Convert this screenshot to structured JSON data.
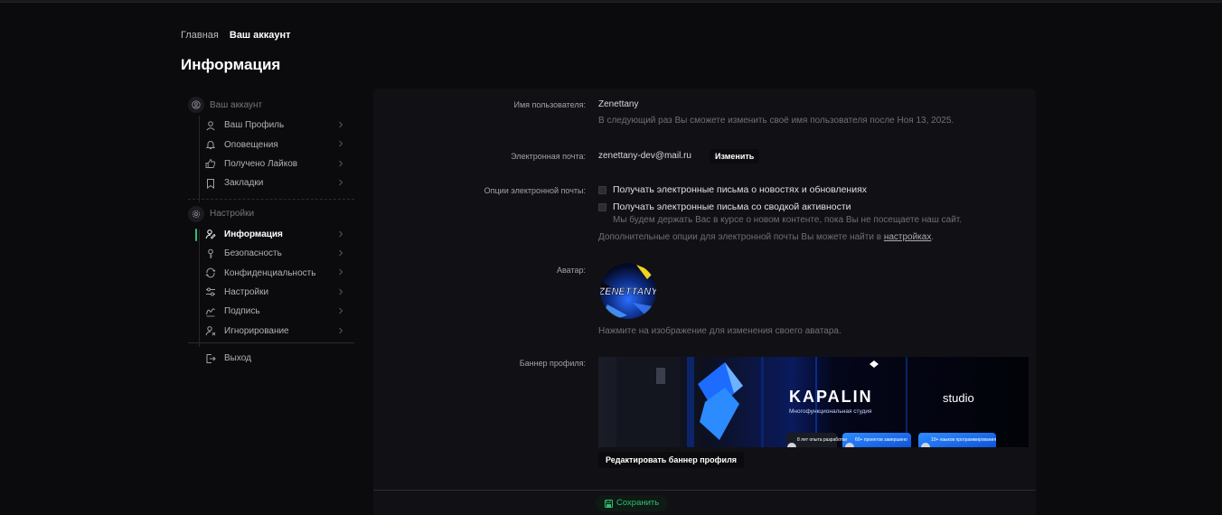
{
  "breadcrumb": {
    "home": "Главная",
    "current": "Ваш аккаунт"
  },
  "page_title": "Информация",
  "sidebar": {
    "account_group": "Ваш аккаунт",
    "account_items": [
      {
        "label": "Ваш Профиль",
        "icon": "user-icon"
      },
      {
        "label": "Оповещения",
        "icon": "bell-icon"
      },
      {
        "label": "Получено Лайков",
        "icon": "thumbs-up-icon"
      },
      {
        "label": "Закладки",
        "icon": "bookmark-icon"
      }
    ],
    "settings_group": "Настройки",
    "settings_items": [
      {
        "label": "Информация",
        "icon": "user-edit-icon",
        "active": true
      },
      {
        "label": "Безопасность",
        "icon": "key-icon"
      },
      {
        "label": "Конфиденциальность",
        "icon": "privacy-icon"
      },
      {
        "label": "Настройки",
        "icon": "sliders-icon"
      },
      {
        "label": "Подпись",
        "icon": "signature-icon"
      },
      {
        "label": "Игнорирование",
        "icon": "user-ignore-icon"
      }
    ],
    "logout": "Выход"
  },
  "form": {
    "username_label": "Имя пользователя:",
    "username_value": "Zenettany",
    "username_hint": "В следующий раз Вы сможете изменить своё имя пользователя после Ноя 13, 2025.",
    "email_label": "Электронная почта:",
    "email_value": "zenettany-dev@mail.ru",
    "email_change": "Изменить",
    "email_options_label": "Опции электронной почты:",
    "option_news": "Получать электронные письма о новостях и обновлениях",
    "option_activity": "Получать электронные письма со сводкой активности",
    "option_activity_hint": "Мы будем держать Вас в курсе о новом контенте, пока Вы не посещаете наш сайт.",
    "options_more_prefix": "Дополнительные опции для электронной почты Вы можете найти в ",
    "options_more_link": "настройках",
    "options_more_suffix": ".",
    "avatar_label": "Аватар:",
    "avatar_text": "ZENETTANY",
    "avatar_hint": "Нажмите на изображение для изменения своего аватара.",
    "banner_label": "Баннер профиля:",
    "banner_brand": "KAPALIN",
    "banner_studio": "studio",
    "banner_subtitle": "Многофункциональная студия",
    "banner_badges": [
      "8 лет опыта разработки",
      "60+ проектов завершено",
      "10+ языков программирования"
    ],
    "edit_banner": "Редактировать баннер профиля",
    "save": "Сохранить"
  }
}
